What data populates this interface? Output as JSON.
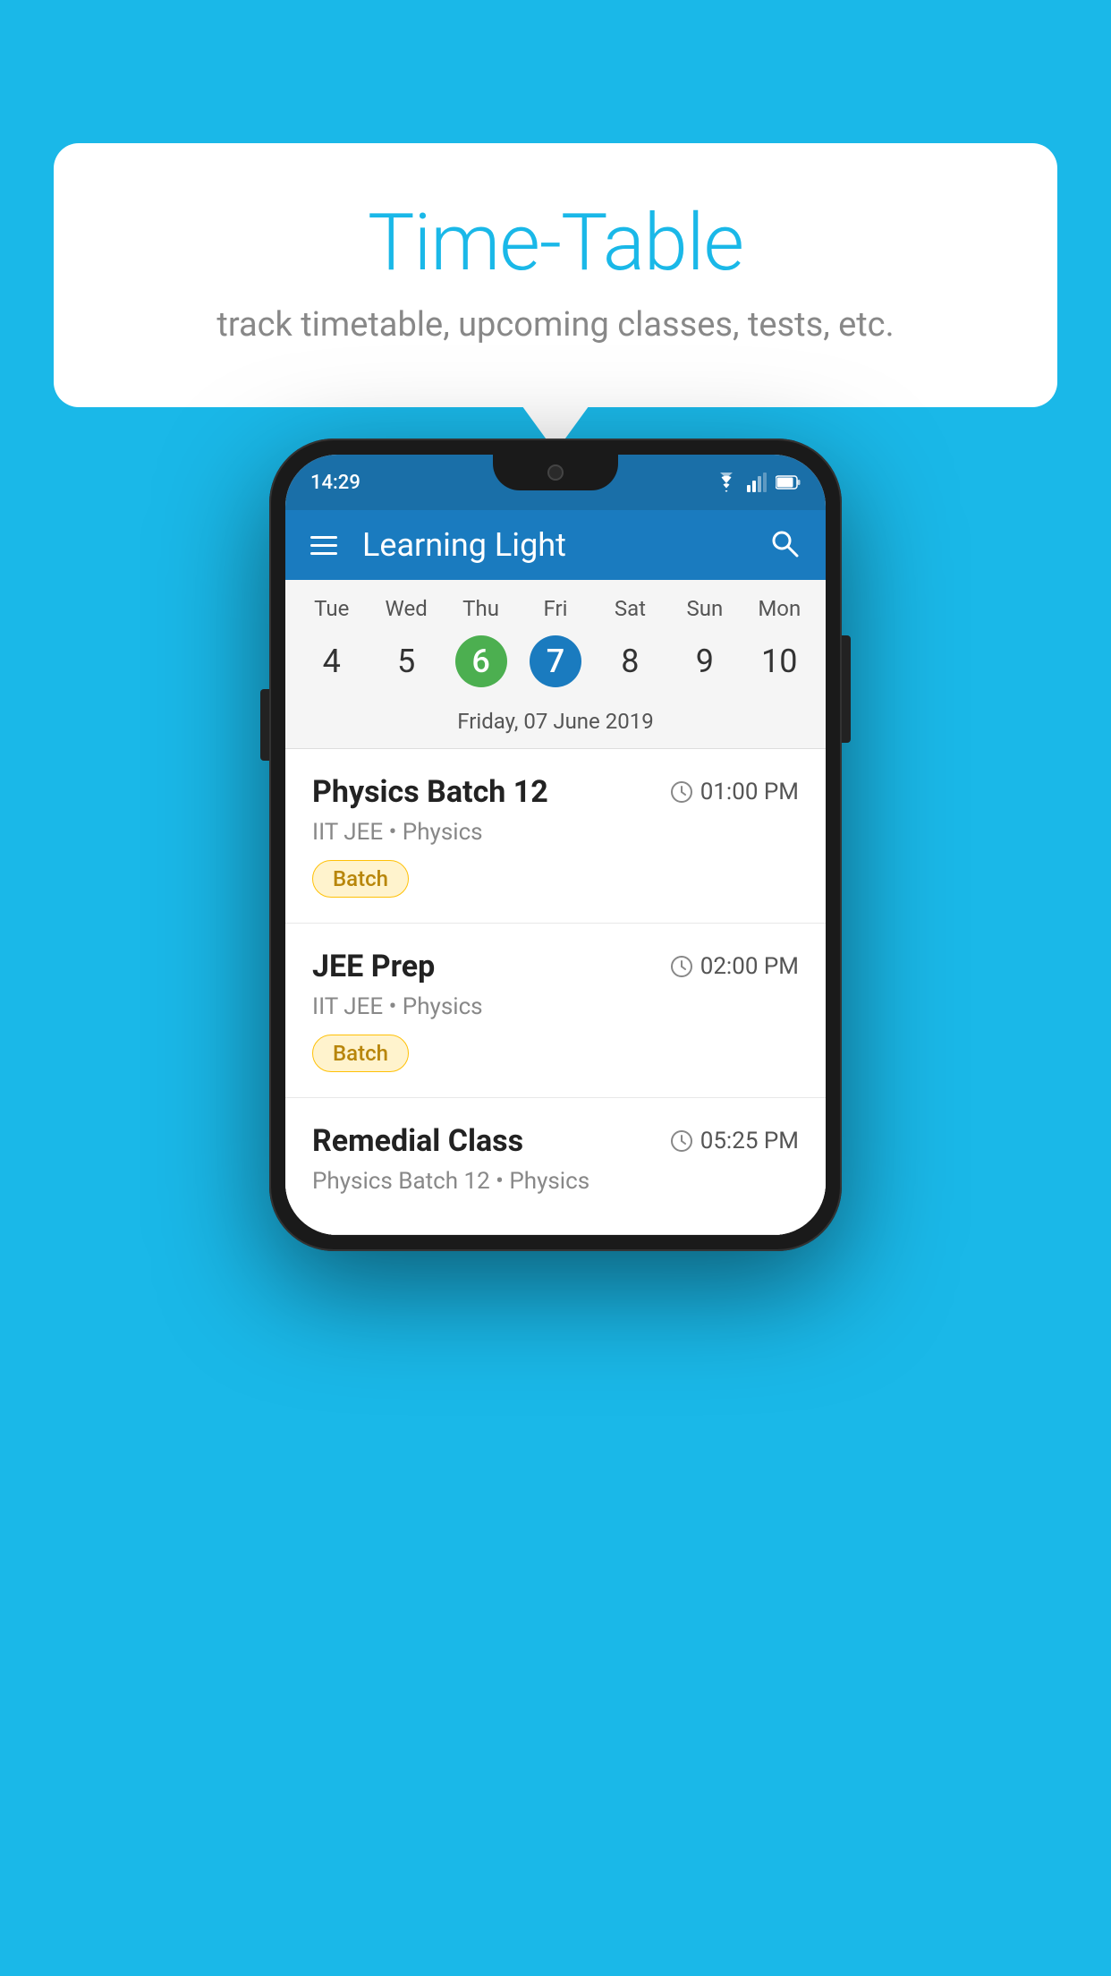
{
  "background": {
    "color": "#1ab8e8"
  },
  "speech_bubble": {
    "title": "Time-Table",
    "subtitle": "track timetable, upcoming classes, tests, etc."
  },
  "phone": {
    "status_bar": {
      "time": "14:29",
      "icons": [
        "wifi",
        "signal",
        "battery"
      ]
    },
    "app_bar": {
      "title": "Learning Light"
    },
    "calendar": {
      "day_headers": [
        "Tue",
        "Wed",
        "Thu",
        "Fri",
        "Sat",
        "Sun",
        "Mon"
      ],
      "day_numbers": [
        "4",
        "5",
        "6",
        "7",
        "8",
        "9",
        "10"
      ],
      "today_index": 2,
      "selected_index": 3,
      "selected_date_label": "Friday, 07 June 2019"
    },
    "schedule_items": [
      {
        "title": "Physics Batch 12",
        "time": "01:00 PM",
        "subtitle": "IIT JEE • Physics",
        "badge": "Batch"
      },
      {
        "title": "JEE Prep",
        "time": "02:00 PM",
        "subtitle": "IIT JEE • Physics",
        "badge": "Batch"
      },
      {
        "title": "Remedial Class",
        "time": "05:25 PM",
        "subtitle": "Physics Batch 12 • Physics",
        "badge": ""
      }
    ]
  }
}
